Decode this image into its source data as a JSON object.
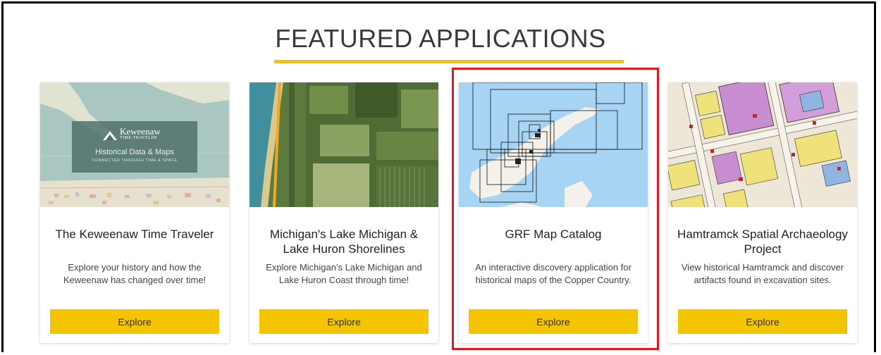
{
  "section": {
    "title": "FEATURED APPLICATIONS",
    "accent_color": "#f5c400",
    "highlight_color": "#e4171c"
  },
  "cards": [
    {
      "title": "The Keweenaw Time Traveler",
      "description": "Explore your history and how the Keweenaw has changed over time!",
      "button": "Explore",
      "thumbnail": {
        "logo_name": "Keweenaw",
        "logo_sub": "TIME TRAVELER",
        "tagline": "Historical Data & Maps",
        "tagline_sub": "CONNECTED THROUGH TIME & SPACE"
      }
    },
    {
      "title": "Michigan's Lake Michigan & Lake Huron Shorelines",
      "description": "Explore Michigan's Lake Michigan and Lake Huron Coast through time!",
      "button": "Explore"
    },
    {
      "title": "GRF Map Catalog",
      "description": "An interactive discovery application for historical maps of the Copper Country.",
      "button": "Explore",
      "highlighted": true
    },
    {
      "title": "Hamtramck Spatial Archaeology Project",
      "description": "View historical Hamtramck and discover artifacts found in excavation sites.",
      "button": "Explore"
    }
  ]
}
